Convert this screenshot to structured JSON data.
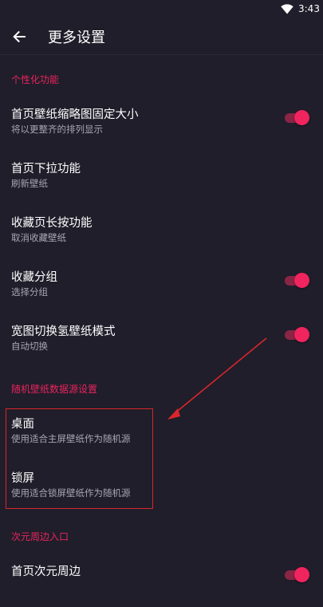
{
  "status_bar": {
    "time": "3:43",
    "wifi_icon": "wifi-icon"
  },
  "app_bar": {
    "back_icon": "arrow-left-icon",
    "title": "更多设置"
  },
  "sections": {
    "personalize": {
      "header": "个性化功能",
      "items": [
        {
          "title": "首页壁纸缩略图固定大小",
          "subtitle": "将以更整齐的排列显示",
          "toggle": true,
          "checked": true
        },
        {
          "title": "首页下拉功能",
          "subtitle": "刷新壁纸",
          "toggle": false
        },
        {
          "title": "收藏页长按功能",
          "subtitle": "取消收藏壁纸",
          "toggle": false
        },
        {
          "title": "收藏分组",
          "subtitle": "选择分组",
          "toggle": true,
          "checked": true
        },
        {
          "title": "宽图切换氢壁纸模式",
          "subtitle": "自动切换",
          "toggle": true,
          "checked": true
        }
      ]
    },
    "random_source": {
      "header": "随机壁纸数据源设置",
      "items": [
        {
          "title": "桌面",
          "subtitle": "使用适合主屏壁纸作为随机源"
        },
        {
          "title": "锁屏",
          "subtitle": "使用适合锁屏壁纸作为随机源"
        }
      ]
    },
    "acg": {
      "header": "次元周边入口",
      "items": [
        {
          "title": "首页次元周边",
          "subtitle": "",
          "toggle": true,
          "checked": true
        }
      ]
    }
  },
  "colors": {
    "background": "#201e2a",
    "accent": "#f0245e",
    "annotation_red": "#d8262c"
  }
}
